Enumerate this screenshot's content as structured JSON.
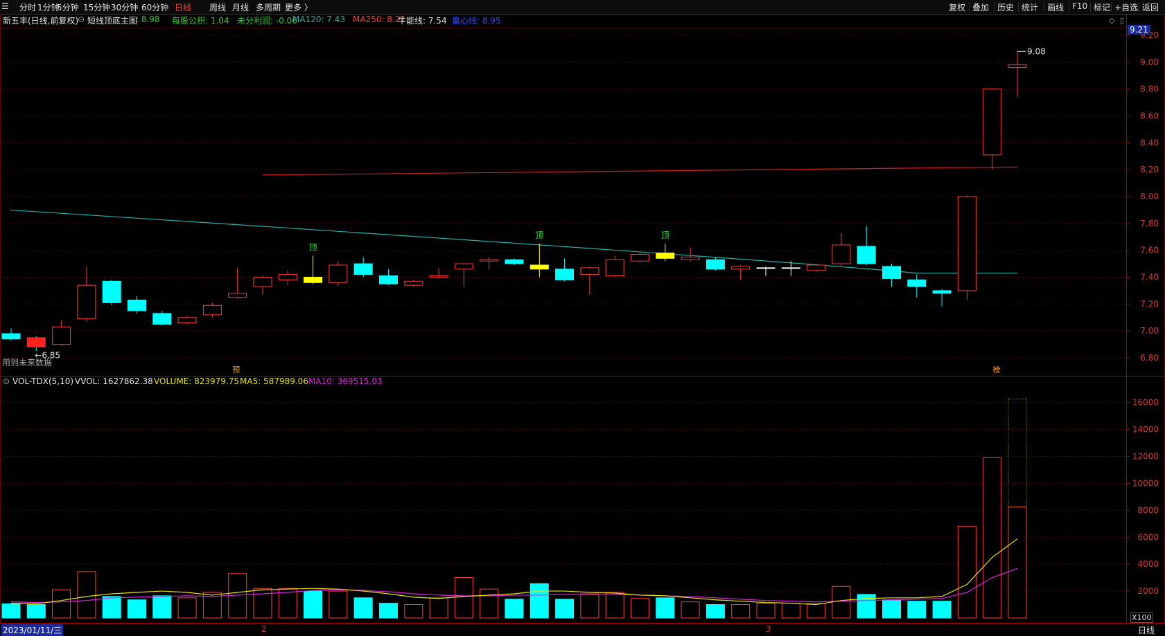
{
  "toolbar": {
    "periods": [
      "分时",
      "1分钟",
      "5分钟",
      "15分钟",
      "30分钟",
      "60分钟",
      "日线",
      "周线",
      "月线",
      "多周期",
      "更多 〉"
    ],
    "active_period": "日线",
    "actions": [
      "复权",
      "叠加",
      "历史",
      "统计",
      "画线",
      "F10",
      "标记",
      "+自选",
      "返回"
    ]
  },
  "main_header": {
    "stock": "新五丰(日线,前复权)",
    "indicator": "短线顶底主图",
    "indicator_value": ": 8.98",
    "items": [
      {
        "label": "每股公积:",
        "value": "1.04",
        "color": "#33cc33"
      },
      {
        "label": "未分利润:",
        "value": "-0.06",
        "color": "#33cc33"
      },
      {
        "label": "MA120:",
        "value": "7.43",
        "color": "#20b2aa"
      },
      {
        "label": "MA250:",
        "value": "8.22",
        "color": "#ff3b3b"
      },
      {
        "label": "牛能线:",
        "value": "7.54",
        "color": "#e0e0e0"
      },
      {
        "label": "重心线:",
        "value": "8.95",
        "color": "#2b4bff"
      }
    ]
  },
  "volume_header": {
    "name": "VOL-TDX(5,10)",
    "vvol": "VVOL: 1627862.38",
    "volume": "VOLUME: 823979.75",
    "ma5": "MA5: 587989.06",
    "ma10": "MA10: 369515.03"
  },
  "labels": {
    "future_note": "用到未来数据",
    "low_mark": "←6.85",
    "high_mark": "9.08",
    "price_tag": "9.21",
    "top_marks": [
      "顶",
      "顶",
      "顶"
    ],
    "pre_mark": "预",
    "bang_mark": "榜",
    "volume_unit": "X100",
    "date_cursor": "2023/01/11/三",
    "month_2": "2",
    "month_3": "3",
    "period_label": "日线"
  },
  "colors": {
    "up": "#ff3b3b",
    "down": "#00ffff",
    "ma120": "#20b2aa",
    "ma250": "#cc2020",
    "ma5_vol": "#e6e600",
    "ma10_vol": "#e020e0",
    "grid": "#5a0000",
    "highlight": "#ffff00"
  },
  "chart_data": [
    {
      "type": "candlestick",
      "y_ticks": [
        "9.20",
        "9.00",
        "8.80",
        "8.60",
        "8.40",
        "8.20",
        "8.00",
        "7.80",
        "7.60",
        "7.40",
        "7.20",
        "7.00",
        "6.80"
      ],
      "ylim": [
        6.7,
        9.25
      ],
      "candles": [
        {
          "o": 6.98,
          "c": 6.94,
          "h": 7.02,
          "l": 6.93
        },
        {
          "o": 6.95,
          "c": 6.88,
          "h": 6.96,
          "l": 6.85
        },
        {
          "o": 6.9,
          "c": 7.03,
          "h": 7.08,
          "l": 6.89
        },
        {
          "o": 7.09,
          "c": 7.34,
          "h": 7.48,
          "l": 7.07
        },
        {
          "o": 7.37,
          "c": 7.21,
          "h": 7.38,
          "l": 7.19
        },
        {
          "o": 7.23,
          "c": 7.15,
          "h": 7.26,
          "l": 7.13
        },
        {
          "o": 7.13,
          "c": 7.05,
          "h": 7.15,
          "l": 7.04
        },
        {
          "o": 7.06,
          "c": 7.1,
          "h": 7.11,
          "l": 7.05
        },
        {
          "o": 7.12,
          "c": 7.19,
          "h": 7.21,
          "l": 7.1
        },
        {
          "o": 7.25,
          "c": 7.28,
          "h": 7.47,
          "l": 7.24
        },
        {
          "o": 7.33,
          "c": 7.4,
          "h": 7.41,
          "l": 7.27
        },
        {
          "o": 7.38,
          "c": 7.42,
          "h": 7.45,
          "l": 7.34
        },
        {
          "o": 7.4,
          "c": 7.36,
          "h": 7.56,
          "l": 7.35
        },
        {
          "o": 7.36,
          "c": 7.49,
          "h": 7.52,
          "l": 7.33
        },
        {
          "o": 7.5,
          "c": 7.42,
          "h": 7.55,
          "l": 7.4
        },
        {
          "o": 7.41,
          "c": 7.35,
          "h": 7.46,
          "l": 7.34
        },
        {
          "o": 7.34,
          "c": 7.37,
          "h": 7.38,
          "l": 7.33
        },
        {
          "o": 7.4,
          "c": 7.41,
          "h": 7.47,
          "l": 7.39
        },
        {
          "o": 7.46,
          "c": 7.5,
          "h": 7.51,
          "l": 7.33
        },
        {
          "o": 7.52,
          "c": 7.53,
          "h": 7.55,
          "l": 7.46
        },
        {
          "o": 7.53,
          "c": 7.5,
          "h": 7.54,
          "l": 7.49
        },
        {
          "o": 7.49,
          "c": 7.46,
          "h": 7.65,
          "l": 7.4
        },
        {
          "o": 7.46,
          "c": 7.38,
          "h": 7.54,
          "l": 7.37
        },
        {
          "o": 7.42,
          "c": 7.47,
          "h": 7.48,
          "l": 7.27
        },
        {
          "o": 7.41,
          "c": 7.53,
          "h": 7.56,
          "l": 7.4
        },
        {
          "o": 7.52,
          "c": 7.57,
          "h": 7.59,
          "l": 7.51
        },
        {
          "o": 7.58,
          "c": 7.54,
          "h": 7.65,
          "l": 7.52
        },
        {
          "o": 7.53,
          "c": 7.55,
          "h": 7.62,
          "l": 7.52
        },
        {
          "o": 7.53,
          "c": 7.46,
          "h": 7.55,
          "l": 7.45
        },
        {
          "o": 7.46,
          "c": 7.48,
          "h": 7.49,
          "l": 7.38
        },
        {
          "o": 7.47,
          "c": 7.47,
          "h": 7.48,
          "l": 7.41
        },
        {
          "o": 7.47,
          "c": 7.47,
          "h": 7.52,
          "l": 7.41
        },
        {
          "o": 7.45,
          "c": 7.49,
          "h": 7.5,
          "l": 7.44
        },
        {
          "o": 7.5,
          "c": 7.64,
          "h": 7.73,
          "l": 7.49
        },
        {
          "o": 7.63,
          "c": 7.5,
          "h": 7.78,
          "l": 7.49
        },
        {
          "o": 7.48,
          "c": 7.39,
          "h": 7.5,
          "l": 7.33
        },
        {
          "o": 7.38,
          "c": 7.33,
          "h": 7.42,
          "l": 7.25
        },
        {
          "o": 7.3,
          "c": 7.28,
          "h": 7.31,
          "l": 7.18
        },
        {
          "o": 7.3,
          "c": 8.0,
          "h": 8.01,
          "l": 7.23
        },
        {
          "o": 8.31,
          "c": 8.8,
          "h": 8.81,
          "l": 8.2
        },
        {
          "o": 8.96,
          "c": 8.98,
          "h": 9.08,
          "l": 8.74
        }
      ],
      "ma120": {
        "x_start": 0,
        "x_end": 40,
        "y_start": 7.9,
        "y_end": 7.43
      },
      "ma250": {
        "x_start": 10,
        "x_end": 40,
        "y_start": 8.16,
        "y_end": 8.22
      },
      "top_signal_index": [
        12,
        21,
        26
      ],
      "highlight_index": [
        12,
        21,
        26
      ]
    },
    {
      "type": "bar",
      "y_ticks": [
        "16000",
        "14000",
        "12000",
        "10000",
        "8000",
        "6000",
        "4000",
        "2000"
      ],
      "ylim": [
        0,
        17000
      ],
      "values": [
        1050,
        1000,
        2100,
        3450,
        1600,
        1350,
        1650,
        1500,
        1900,
        3300,
        2200,
        2200,
        2000,
        2000,
        1500,
        1100,
        1000,
        1500,
        3000,
        2150,
        1400,
        2550,
        1400,
        1800,
        1900,
        1450,
        1500,
        1200,
        1000,
        1000,
        1100,
        1100,
        1100,
        2350,
        1750,
        1350,
        1250,
        1250,
        6800,
        11900,
        8240
      ],
      "volume_projection": 16280,
      "ma5": [
        1100,
        1050,
        1300,
        1600,
        1800,
        1900,
        2000,
        1900,
        1700,
        1900,
        2100,
        2150,
        2200,
        2150,
        2000,
        1800,
        1550,
        1450,
        1600,
        1700,
        1800,
        2000,
        2000,
        1900,
        1850,
        1700,
        1650,
        1500,
        1350,
        1250,
        1150,
        1100,
        1000,
        1300,
        1450,
        1500,
        1500,
        1600,
        2500,
        4500,
        5880
      ],
      "ma10": [
        1200,
        1150,
        1200,
        1300,
        1500,
        1550,
        1600,
        1650,
        1600,
        1700,
        1800,
        1900,
        2050,
        2100,
        2050,
        1950,
        1800,
        1700,
        1650,
        1650,
        1700,
        1700,
        1750,
        1750,
        1750,
        1700,
        1650,
        1600,
        1500,
        1400,
        1300,
        1250,
        1200,
        1250,
        1300,
        1350,
        1400,
        1450,
        1900,
        3000,
        3680
      ]
    }
  ]
}
